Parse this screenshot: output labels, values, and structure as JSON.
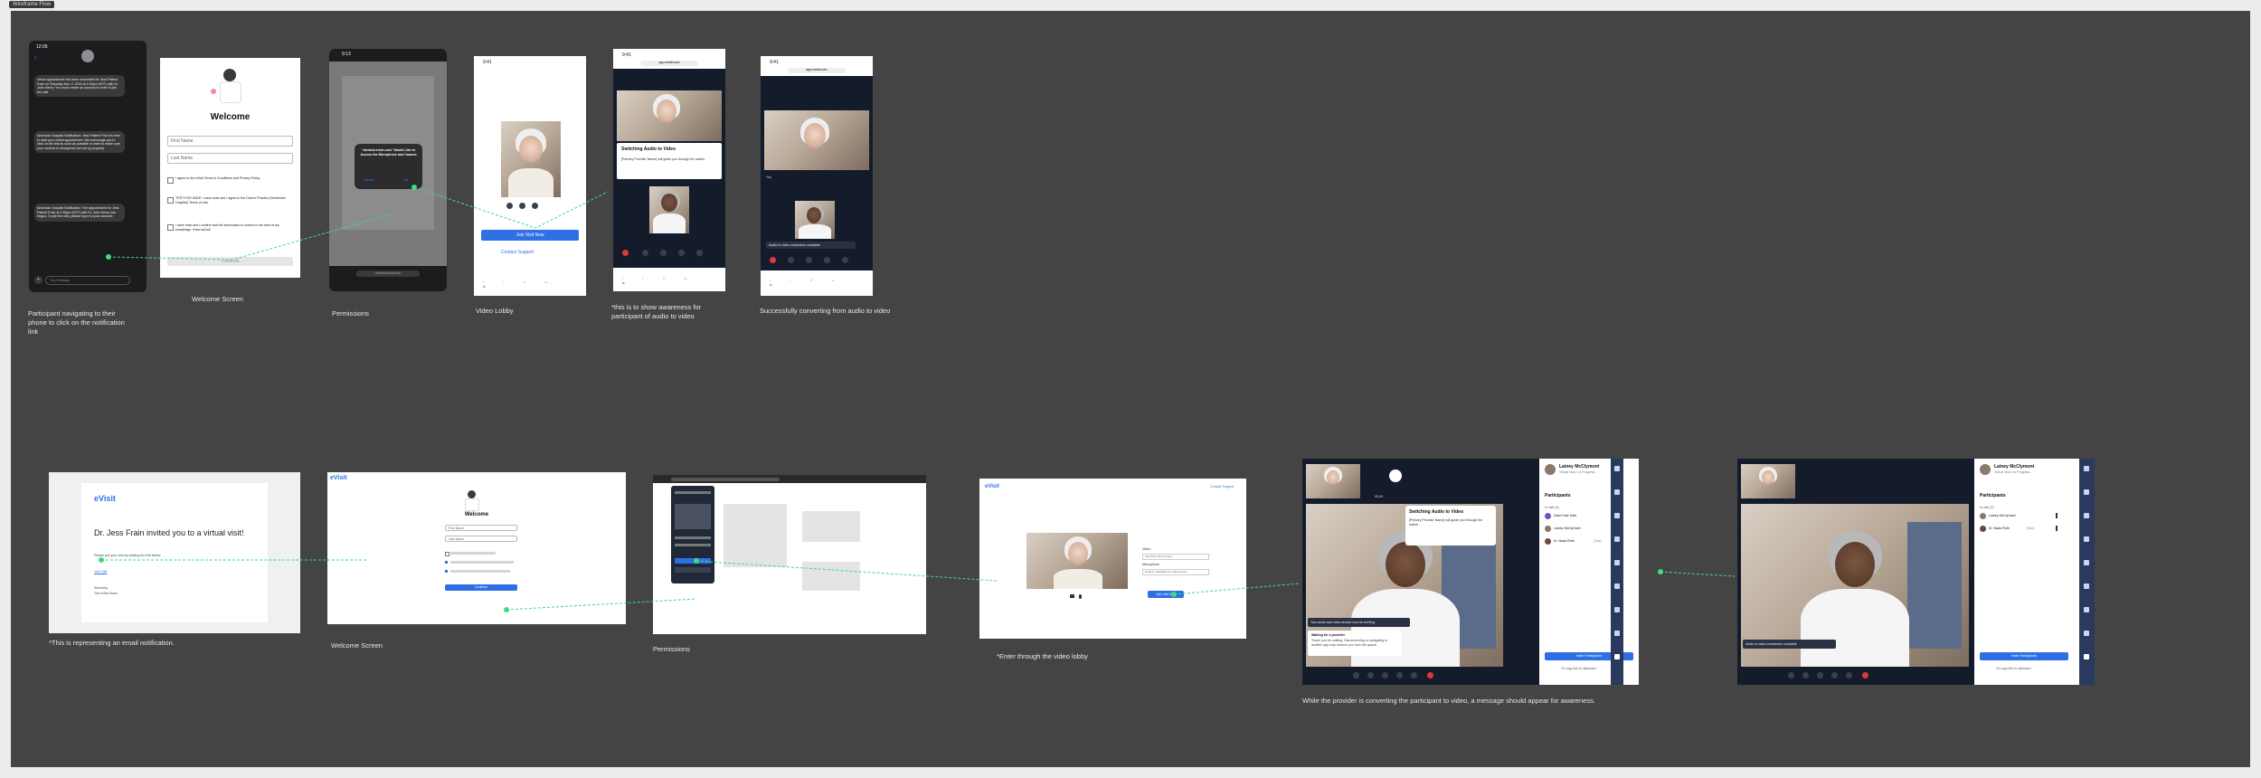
{
  "frame_tag": "Wireframe Flow",
  "captions": {
    "c1": "Participant navigating to their\nphone to click on the notification\nlink",
    "c2": "Welcome Screen",
    "c3": "Permissions",
    "c4": "Video Lobby",
    "c5": "*this is to show awareness for\nparticipant of audio to video",
    "c6": "Successfully converting from audio to video",
    "c7": "*This is representing an email notification.",
    "c8": "Welcome Screen",
    "c9": "Permissions",
    "c10": "*Enter through the video lobby",
    "c11": "While the provider is converting the participant to video, a message should appear for awareness."
  },
  "sms": {
    "time": "12:05",
    "msg1": "virtual appointment has been scheduled for Jess Patient Frain on Saturday Nov. 9, 2024 at 2:30pm (EST) with Dr. John Henry. You must create an account in order to join the visit",
    "msg2": "American Hospital Notification: Jess Patient Frain it's time to start your virtual appointment. We encourage you to click on the link as soon as possible in order to make sure your camera & microphone are set up properly.",
    "msg3": "American Hospital Notification: The appointment for Jess Patient Frain at 2:30pm (EST) with Dr. John Henry has begun. To join the visit, please log in to your account.",
    "input_placeholder": "Text Message"
  },
  "welcome_mobile": {
    "title": "Welcome",
    "first_name": "First Name",
    "last_name": "Last Name",
    "agree1": "I agree to the eVisit Terms & Conditions and Privacy Policy",
    "agree2": "TEST FOR DAVE: I have read and I agree to the Dave's Practice (Northwest Hospital) Terms of Use.",
    "agree3": "I have read and I confirm that the information is correct to the best of my knowledge. External link",
    "continue": "Continue"
  },
  "permissions_mobile": {
    "time": "9:13",
    "dialog": "\"devtest.evisit.com\" Would Like to Access the Microphone and Camera",
    "cancel": "Cancel",
    "allow": "OK",
    "url": "devtest.evisit.com"
  },
  "lobby_mobile": {
    "time": "9:41",
    "join": "Join Visit Now",
    "support": "Contact Support"
  },
  "switch_mobile": {
    "time": "9:41",
    "url": "app.evisit.com",
    "title": "Switching Audio to Video",
    "body": "[Primary Provider Name] will guide you through the switch."
  },
  "converted_mobile": {
    "time": "9:41",
    "url": "app.evisit.com",
    "you": "You",
    "toast": "Audio to video conversion complete"
  },
  "email": {
    "brand": "eVisit",
    "headline": "Dr. Jess Frain invited you to a virtual visit!",
    "body": "Please join your visit by clicking the link below:",
    "link": "Join Visit",
    "sign1": "Sincerely,",
    "sign2": "The eVisit Team"
  },
  "welcome_desktop": {
    "brand": "eVisit",
    "title": "Welcome",
    "first_name": "First Name",
    "last_name": "Last Name",
    "continue": "Continue"
  },
  "lobby_desktop": {
    "brand": "eVisit",
    "support": "Contact Support",
    "video_label": "Video",
    "mic_label": "Microphone",
    "cam_option": "FaceTime HD Camera",
    "mic_option": "Default - MacBook Pro Microphone",
    "join": "Join Visit Now"
  },
  "provider_switch": {
    "dialog_title": "Switching Audio to Video",
    "dialog_body": "[Primary Provider Name] will guide you through the switch.",
    "toast": "Your audio and video should now be working",
    "waiting_title": "Waiting for a provider",
    "waiting_body": "Thank you for waiting. Disconnecting or navigating to another app may remove you from the queue.",
    "timer": "00:09",
    "patient_name": "Lainey McClymont",
    "patient_meta": "Virtual Visit • In Progress",
    "participants_header": "Participants",
    "in_visit": "In visit (3)",
    "p1": "Dave Dale Dale",
    "p2": "Lainey McClymont",
    "p3": "Dr. Nada Roth",
    "p3_tag": "(You)",
    "add_btn": "Invite Participants",
    "copy_link": "Or copy link to clipboard"
  },
  "provider_converted": {
    "toast": "Audio to video conversion complete",
    "patient_name": "Lainey McClymont",
    "patient_meta": "Virtual Visit • In Progress",
    "participants_header": "Participants",
    "in_visit": "In visit (2)",
    "p1": "Lainey McClymont",
    "p2": "Dr. Nada Roth",
    "p2_tag": "(You)",
    "add_btn": "Invite Participants",
    "copy_link": "Or copy link to clipboard"
  },
  "colors": {
    "canvas": "#444444",
    "accent": "#2f6fe6",
    "arrow": "#3ddc84",
    "end_call": "#d93a3a"
  }
}
